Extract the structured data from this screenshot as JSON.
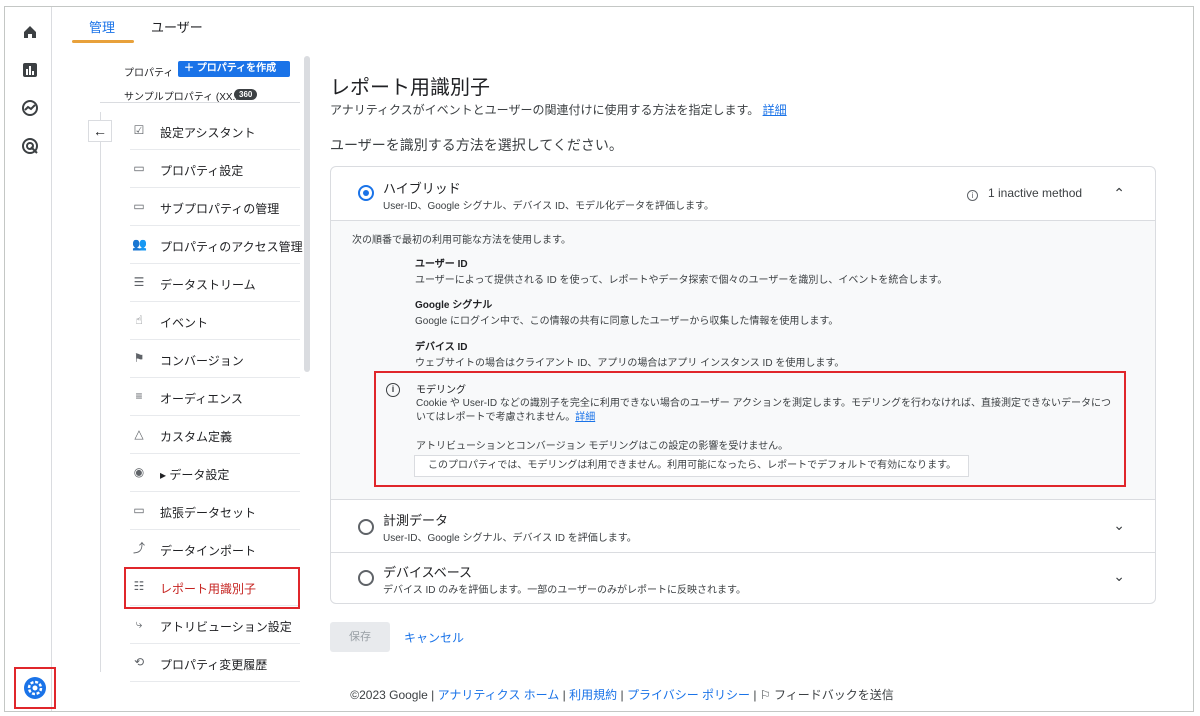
{
  "tabs": [
    "管理",
    "ユーザー"
  ],
  "nav": {
    "property_label": "プロパティ",
    "create_button": "＋ プロパティを作成",
    "sample_property": "サンプルプロパティ (XX...",
    "badge": "360",
    "items": [
      {
        "label": "設定アシスタント",
        "icon": "checkbox-icon",
        "glyph": "☑"
      },
      {
        "label": "プロパティ設定",
        "icon": "property-settings-icon",
        "glyph": "▭"
      },
      {
        "label": "サブプロパティの管理",
        "icon": "subproperty-icon",
        "glyph": "▭"
      },
      {
        "label": "プロパティのアクセス管理",
        "icon": "people-icon",
        "glyph": "👥"
      },
      {
        "label": "データストリーム",
        "icon": "stream-icon",
        "glyph": "☰"
      },
      {
        "label": "イベント",
        "icon": "touch-icon",
        "glyph": "☝"
      },
      {
        "label": "コンバージョン",
        "icon": "flag-icon",
        "glyph": "⚑"
      },
      {
        "label": "オーディエンス",
        "icon": "audience-icon",
        "glyph": "≡"
      },
      {
        "label": "カスタム定義",
        "icon": "shapes-icon",
        "glyph": "△"
      },
      {
        "label": "▸ データ設定",
        "icon": "database-icon",
        "glyph": "◉"
      },
      {
        "label": "拡張データセット",
        "icon": "dataset-icon",
        "glyph": "▭"
      },
      {
        "label": "データインポート",
        "icon": "upload-icon",
        "glyph": "⤴"
      },
      {
        "label": "レポート用識別子",
        "icon": "identifier-icon",
        "glyph": "☷"
      },
      {
        "label": "アトリビューション設定",
        "icon": "attribution-icon",
        "glyph": "⤷"
      },
      {
        "label": "プロパティ変更履歴",
        "icon": "history-icon",
        "glyph": "⟲"
      }
    ]
  },
  "main": {
    "title": "レポート用識別子",
    "description": "アナリティクスがイベントとユーザーの関連付けに使用する方法を指定します。",
    "details_link": "詳細",
    "select_prompt": "ユーザーを識別する方法を選択してください。",
    "options": {
      "hybrid": {
        "title": "ハイブリッド",
        "subtitle": "User-ID、Google シグナル、デバイス ID、モデル化データを評価します。",
        "inactive": "1 inactive method"
      },
      "observed": {
        "title": "計測データ",
        "subtitle": "User-ID、Google シグナル、デバイス ID を評価します。"
      },
      "device": {
        "title": "デバイスベース",
        "subtitle": "デバイス ID のみを評価します。一部のユーザーのみがレポートに反映されます。"
      }
    },
    "expanded": {
      "intro": "次の順番で最初の利用可能な方法を使用します。",
      "methods": [
        {
          "name": "ユーザー ID",
          "desc": "ユーザーによって提供される ID を使って、レポートやデータ探索で個々のユーザーを識別し、イベントを統合します。"
        },
        {
          "name": "Google シグナル",
          "desc": "Google にログイン中で、この情報の共有に同意したユーザーから収集した情報を使用します。"
        },
        {
          "name": "デバイス ID",
          "desc": "ウェブサイトの場合はクライアント ID、アプリの場合はアプリ インスタンス ID を使用します。"
        }
      ],
      "modeling": {
        "title": "モデリング",
        "desc": "Cookie や User-ID などの識別子を完全に利用できない場合のユーザー アクションを測定します。モデリングを行わなければ、直接測定できないデータについてはレポートで考慮されません。",
        "link": "詳細",
        "note": "アトリビューションとコンバージョン モデリングはこの設定の影響を受けません。",
        "field": "このプロパティでは、モデリングは利用できません。利用可能になったら、レポートでデフォルトで有効になります。"
      }
    },
    "save": "保存",
    "cancel": "キャンセル"
  },
  "footer": {
    "copyright": "©2023 Google",
    "sep": "|",
    "home": "アナリティクス ホーム",
    "terms": "利用規約",
    "privacy": "プライバシー ポリシー",
    "feedback": "フィードバックを送信"
  },
  "colors": {
    "accent": "#1a73e8",
    "highlight": "#e0262b",
    "tab_underline": "#e8a13b"
  }
}
